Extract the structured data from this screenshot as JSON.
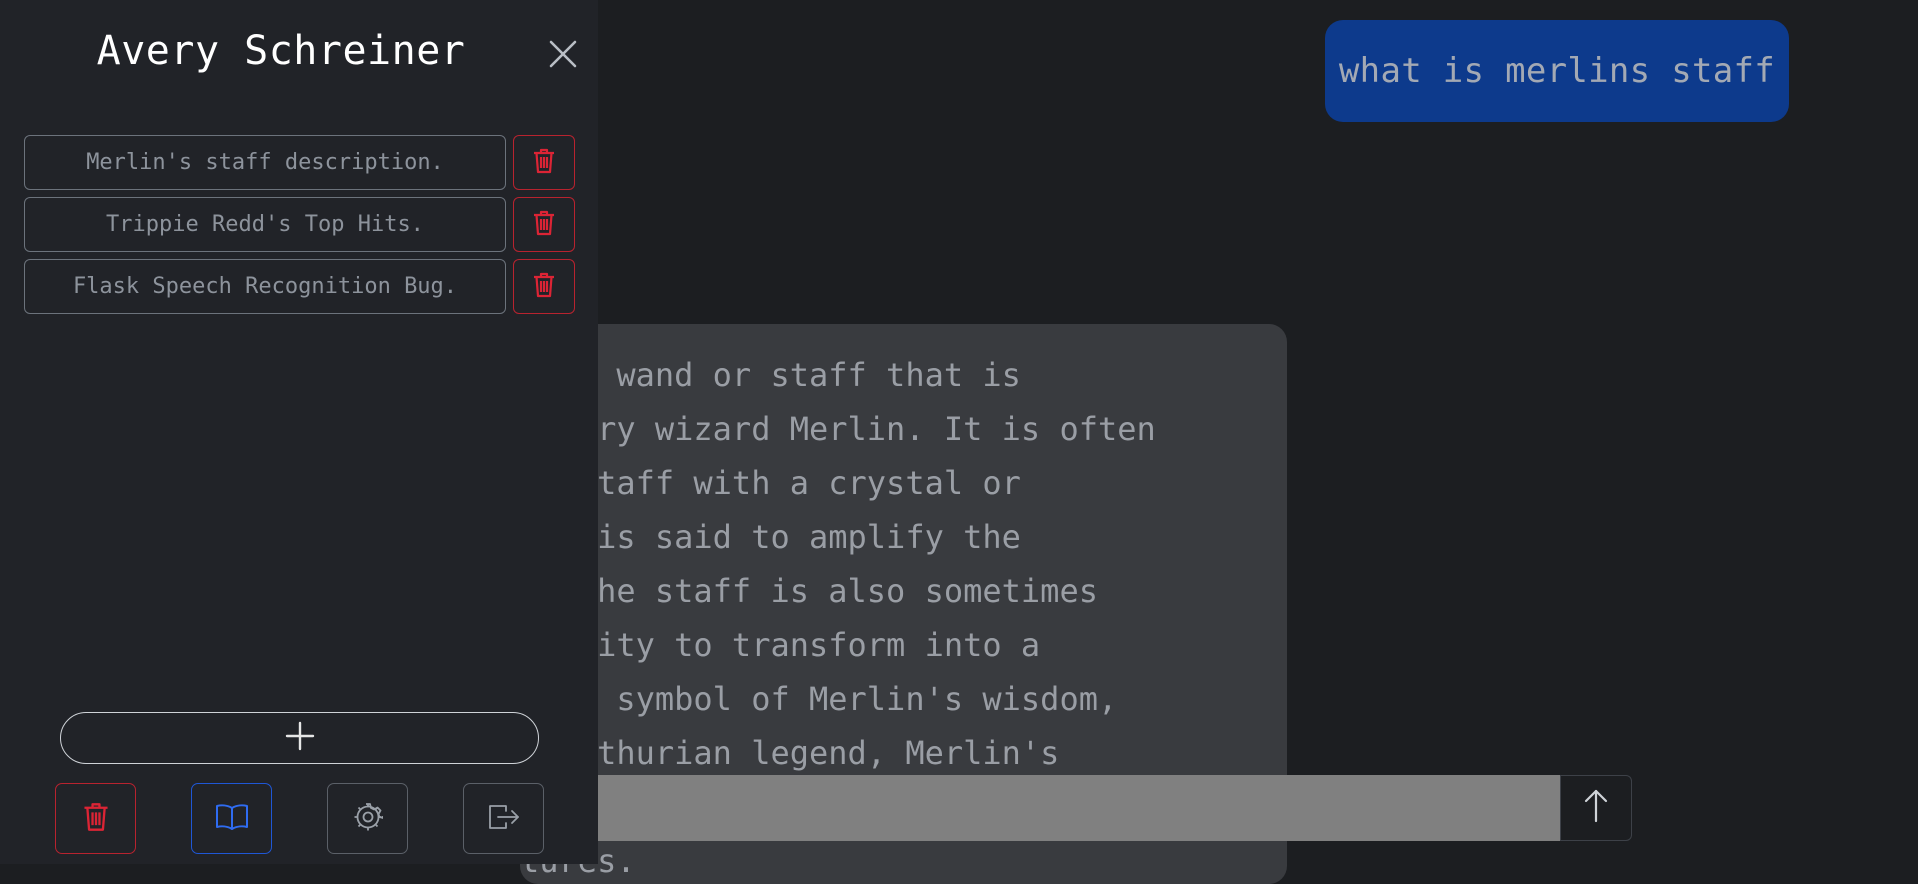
{
  "sidebar": {
    "title": "Avery Schreiner",
    "conversations": [
      {
        "label": "Merlin's staff description."
      },
      {
        "label": "Trippie Redd's Top Hits."
      },
      {
        "label": "Flask Speech Recognition Bug."
      }
    ]
  },
  "chat": {
    "user_message": "what is merlins staff",
    "assistant_lines": [
      "ical wand or staff that is",
      "endary wizard Merlin. It is often",
      "en staff with a crystal or",
      "ich is said to amplify the",
      "s. The staff is also sometimes",
      "ability to transform into a",
      "is a symbol of Merlin's wisdom,",
      "n Arthurian legend, Merlin's",
      "",
      "tures."
    ],
    "input_value": ""
  },
  "colors": {
    "sidebar_bg": "#212328",
    "main_bg": "#1c1e21",
    "user_bubble": "#0d3a8c",
    "assistant_bubble": "#393b3f",
    "danger": "#b8232f",
    "primary": "#1f57d6"
  },
  "icons": {
    "close": "close-icon",
    "trash": "trash-icon",
    "plus": "plus-icon",
    "book": "book-icon",
    "gear": "gear-icon",
    "logout": "logout-icon",
    "send": "arrow-up-icon"
  }
}
